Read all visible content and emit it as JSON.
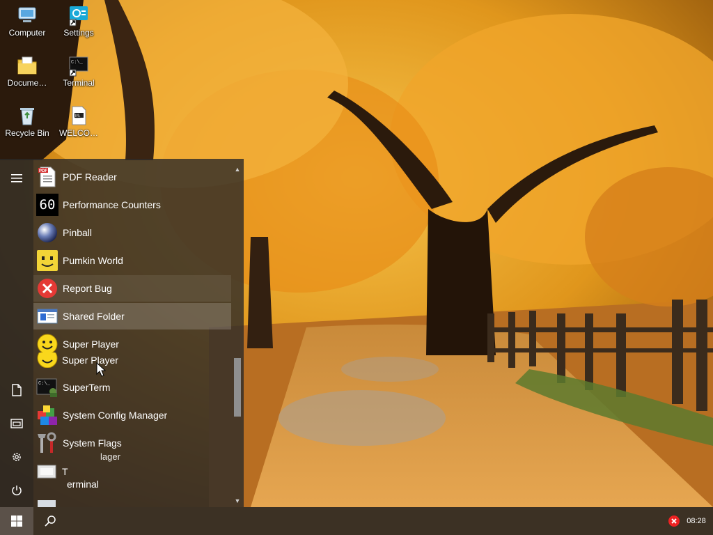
{
  "desktop": {
    "icons": [
      {
        "label": "Computer",
        "icon": "computer-icon"
      },
      {
        "label": "Settings",
        "icon": "settings-shortcut-icon"
      },
      {
        "label": "Docume…",
        "icon": "documents-folder-icon"
      },
      {
        "label": "Terminal",
        "icon": "terminal-shortcut-icon"
      },
      {
        "label": "Recycle Bin",
        "icon": "recycle-bin-icon"
      },
      {
        "label": "WELCO…",
        "icon": "welcome-document-icon"
      }
    ]
  },
  "start_menu": {
    "rail": {
      "hamburger": "hamburger-menu-icon",
      "documents": "document-icon",
      "pictures": "pictures-folder-icon",
      "settings": "gear-icon",
      "power": "power-icon"
    },
    "apps": [
      {
        "label": "PDF Reader",
        "icon": "pdf-icon"
      },
      {
        "label": "Performance Counters",
        "icon": "performance-counter-icon",
        "icon_text": "60"
      },
      {
        "label": "Pinball",
        "icon": "pinball-icon"
      },
      {
        "label": "Pumkin World",
        "icon": "pumpkin-icon"
      },
      {
        "label": "Report Bug",
        "icon": "report-bug-icon",
        "state": "hover"
      },
      {
        "label": "Shared Folder",
        "icon": "shared-folder-icon",
        "state": "selected"
      },
      {
        "label": "Super Player",
        "icon": "smiley-icon"
      },
      {
        "label": "SuperTerm",
        "icon": "superterm-icon"
      },
      {
        "label": "System Config Manager",
        "icon": "config-manager-icon"
      },
      {
        "label": "System Flags",
        "icon": "system-flags-icon"
      }
    ],
    "ghost_texts": {
      "super_player": "Super Player",
      "config_fragment": "lager",
      "terminal_t": "T",
      "terminal_rest": "erminal"
    },
    "scroll": {
      "up": "▲",
      "down": "▼"
    }
  },
  "taskbar": {
    "start_icon": "windows-start-icon",
    "search_icon": "search-icon",
    "tray_alert_icon": "error-tray-icon",
    "clock": "08:28"
  },
  "colors": {
    "accent_red": "#e22222",
    "menu_bg": "#302c28",
    "taskbar_bg": "#3c3124"
  }
}
